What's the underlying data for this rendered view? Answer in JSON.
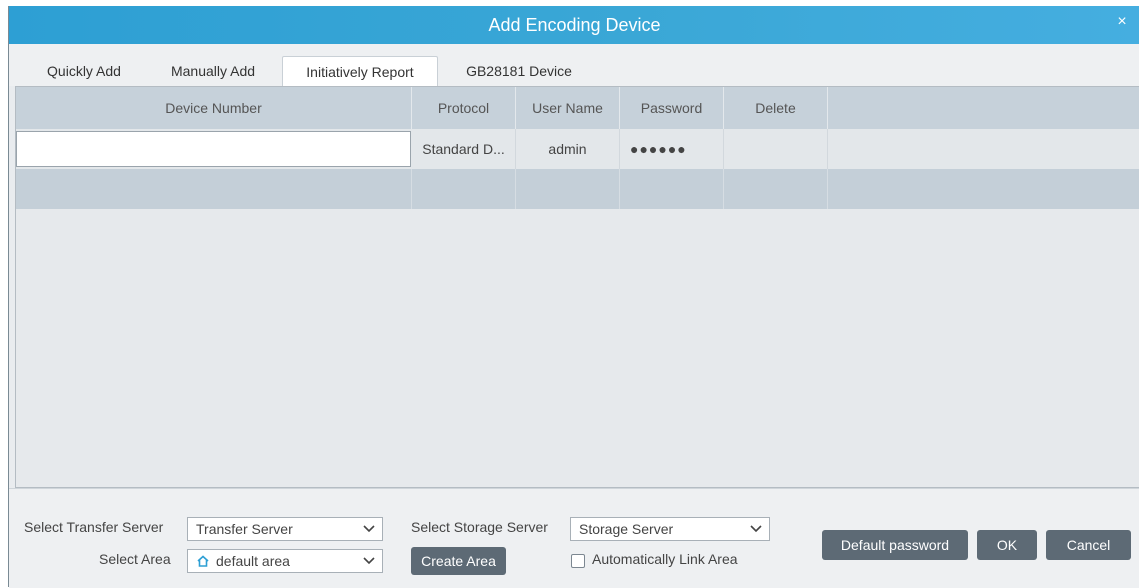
{
  "window": {
    "title": "Add Encoding Device",
    "close_glyph": "×"
  },
  "tabs": [
    {
      "label": "Quickly Add"
    },
    {
      "label": "Manually Add"
    },
    {
      "label": "Initiatively Report",
      "active": true
    },
    {
      "label": "GB28181 Device"
    }
  ],
  "table": {
    "columns": [
      "Device Number",
      "Protocol",
      "User Name",
      "Password",
      "Delete"
    ],
    "rows": [
      {
        "device_number": "",
        "protocol": "Standard D...",
        "user_name": "admin",
        "password": "●●●●●●",
        "delete": ""
      }
    ]
  },
  "footer": {
    "transfer_label": "Select Transfer Server",
    "transfer_value": "Transfer Server",
    "storage_label": "Select Storage Server",
    "storage_value": "Storage Server",
    "area_label": "Select Area",
    "area_value": "default area",
    "create_area": "Create Area",
    "auto_link": "Automatically Link Area",
    "auto_link_checked": false,
    "default_password": "Default password",
    "ok": "OK",
    "cancel": "Cancel"
  },
  "icons": {
    "close": "close-icon",
    "home": "home-icon",
    "dropdown": "chevron-down-icon"
  },
  "colors": {
    "title_bar": "#3aa7d6",
    "header_row": "#c6d1da",
    "button": "#5d6a75"
  }
}
